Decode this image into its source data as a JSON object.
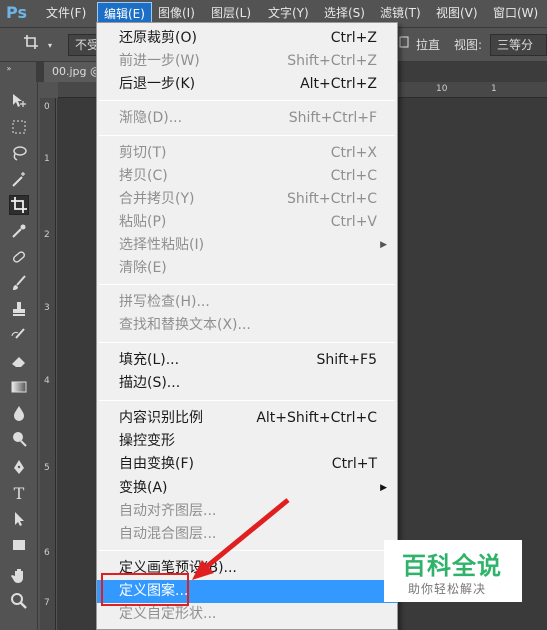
{
  "app": {
    "logo": "Ps"
  },
  "menubar": {
    "items": [
      {
        "label": "文件(F)"
      },
      {
        "label": "编辑(E)"
      },
      {
        "label": "图像(I)"
      },
      {
        "label": "图层(L)"
      },
      {
        "label": "文字(Y)"
      },
      {
        "label": "选择(S)"
      },
      {
        "label": "滤镜(T)"
      },
      {
        "label": "视图(V)"
      },
      {
        "label": "窗口(W)"
      }
    ]
  },
  "options": {
    "left_box": "不受",
    "straighten_label": "拉直",
    "view_label": "视图:",
    "view_value": "三等分"
  },
  "document": {
    "tab_label": "00.jpg @"
  },
  "rulers": {
    "h_ticks": [
      "10",
      "1"
    ],
    "v_ticks": [
      "0",
      "1",
      "2",
      "3",
      "4",
      "5",
      "6",
      "7"
    ]
  },
  "edit_menu": {
    "items": [
      {
        "label": "还原裁剪(O)",
        "shortcut": "Ctrl+Z",
        "disabled": false
      },
      {
        "label": "前进一步(W)",
        "shortcut": "Shift+Ctrl+Z",
        "disabled": true
      },
      {
        "label": "后退一步(K)",
        "shortcut": "Alt+Ctrl+Z",
        "disabled": false
      },
      {
        "label": "渐隐(D)...",
        "shortcut": "Shift+Ctrl+F",
        "disabled": true
      },
      {
        "label": "剪切(T)",
        "shortcut": "Ctrl+X",
        "disabled": true
      },
      {
        "label": "拷贝(C)",
        "shortcut": "Ctrl+C",
        "disabled": true
      },
      {
        "label": "合并拷贝(Y)",
        "shortcut": "Shift+Ctrl+C",
        "disabled": true
      },
      {
        "label": "粘贴(P)",
        "shortcut": "Ctrl+V",
        "disabled": true
      },
      {
        "label": "选择性粘贴(I)",
        "shortcut": "",
        "disabled": true
      },
      {
        "label": "清除(E)",
        "shortcut": "",
        "disabled": true
      },
      {
        "label": "拼写检查(H)...",
        "shortcut": "",
        "disabled": true
      },
      {
        "label": "查找和替换文本(X)...",
        "shortcut": "",
        "disabled": true
      },
      {
        "label": "填充(L)...",
        "shortcut": "Shift+F5",
        "disabled": false
      },
      {
        "label": "描边(S)...",
        "shortcut": "",
        "disabled": false
      },
      {
        "label": "内容识别比例",
        "shortcut": "Alt+Shift+Ctrl+C",
        "disabled": false
      },
      {
        "label": "操控变形",
        "shortcut": "",
        "disabled": false
      },
      {
        "label": "自由变换(F)",
        "shortcut": "Ctrl+T",
        "disabled": false
      },
      {
        "label": "变换(A)",
        "shortcut": "",
        "disabled": false
      },
      {
        "label": "自动对齐图层...",
        "shortcut": "",
        "disabled": true
      },
      {
        "label": "自动混合图层...",
        "shortcut": "",
        "disabled": true
      },
      {
        "label": "定义画笔预设(B)...",
        "shortcut": "",
        "disabled": false
      },
      {
        "label": "定义图案...",
        "shortcut": "",
        "disabled": false
      },
      {
        "label": "定义自定形状...",
        "shortcut": "",
        "disabled": true
      }
    ]
  },
  "watermark": {
    "title": "百科全说",
    "subtitle": "助你轻松解决"
  },
  "colors": {
    "accent": "#1c6fc5",
    "highlight": "#3399ff",
    "annotation": "#e02020",
    "watermark_green": "#2fb36a"
  }
}
